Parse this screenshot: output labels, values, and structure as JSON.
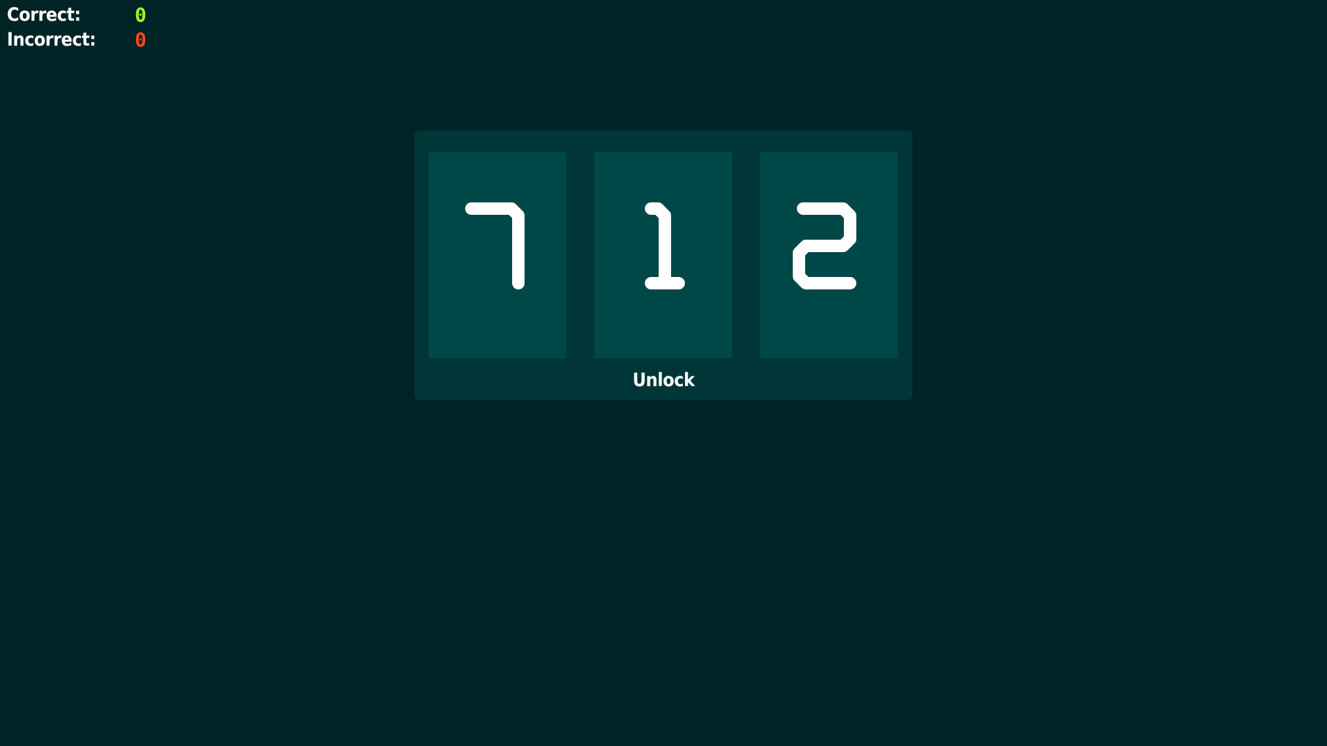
{
  "scoreboard": {
    "correct_label": "Correct:",
    "correct_value": "0",
    "incorrect_label": "Incorrect:",
    "incorrect_value": "0"
  },
  "colors": {
    "background": "#002426",
    "panel": "#003638",
    "slot": "#004748",
    "correct": "#9aff1f",
    "incorrect": "#ff4a1a",
    "text": "#ffffff"
  },
  "lock": {
    "digits": [
      "7",
      "1",
      "2"
    ],
    "unlock_label": "Unlock"
  }
}
